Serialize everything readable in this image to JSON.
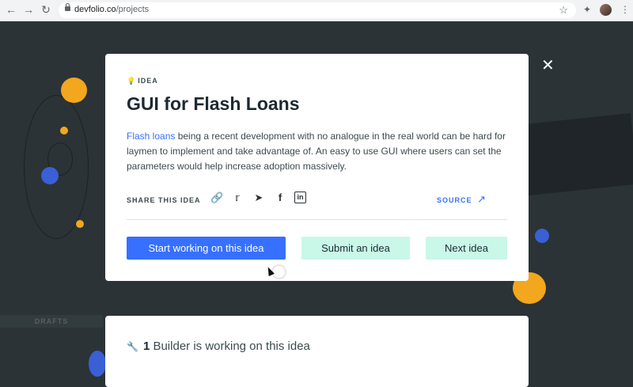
{
  "browser": {
    "url_domain": "devfolio.co",
    "url_path": "/projects"
  },
  "background": {
    "ghost_label": "DRAFTS"
  },
  "modal": {
    "tag": "IDEA",
    "title": "GUI for Flash Loans",
    "description_link": "Flash loans",
    "description_rest": " being a recent development with no analogue in the real world can be hard for laymen to implement and take advantage of. An easy to use GUI where users can set the parameters would help increase adoption massively.",
    "share_label": "SHARE THIS IDEA",
    "source_label": "SOURCE",
    "buttons": {
      "start": "Start working on this idea",
      "submit": "Submit an idea",
      "next": "Next idea"
    }
  },
  "builders": {
    "count": "1",
    "text": " Builder is working on this idea"
  },
  "colors": {
    "accent": "#3770ff",
    "soft_button": "#c9f7e8",
    "background": "#2b3336"
  }
}
